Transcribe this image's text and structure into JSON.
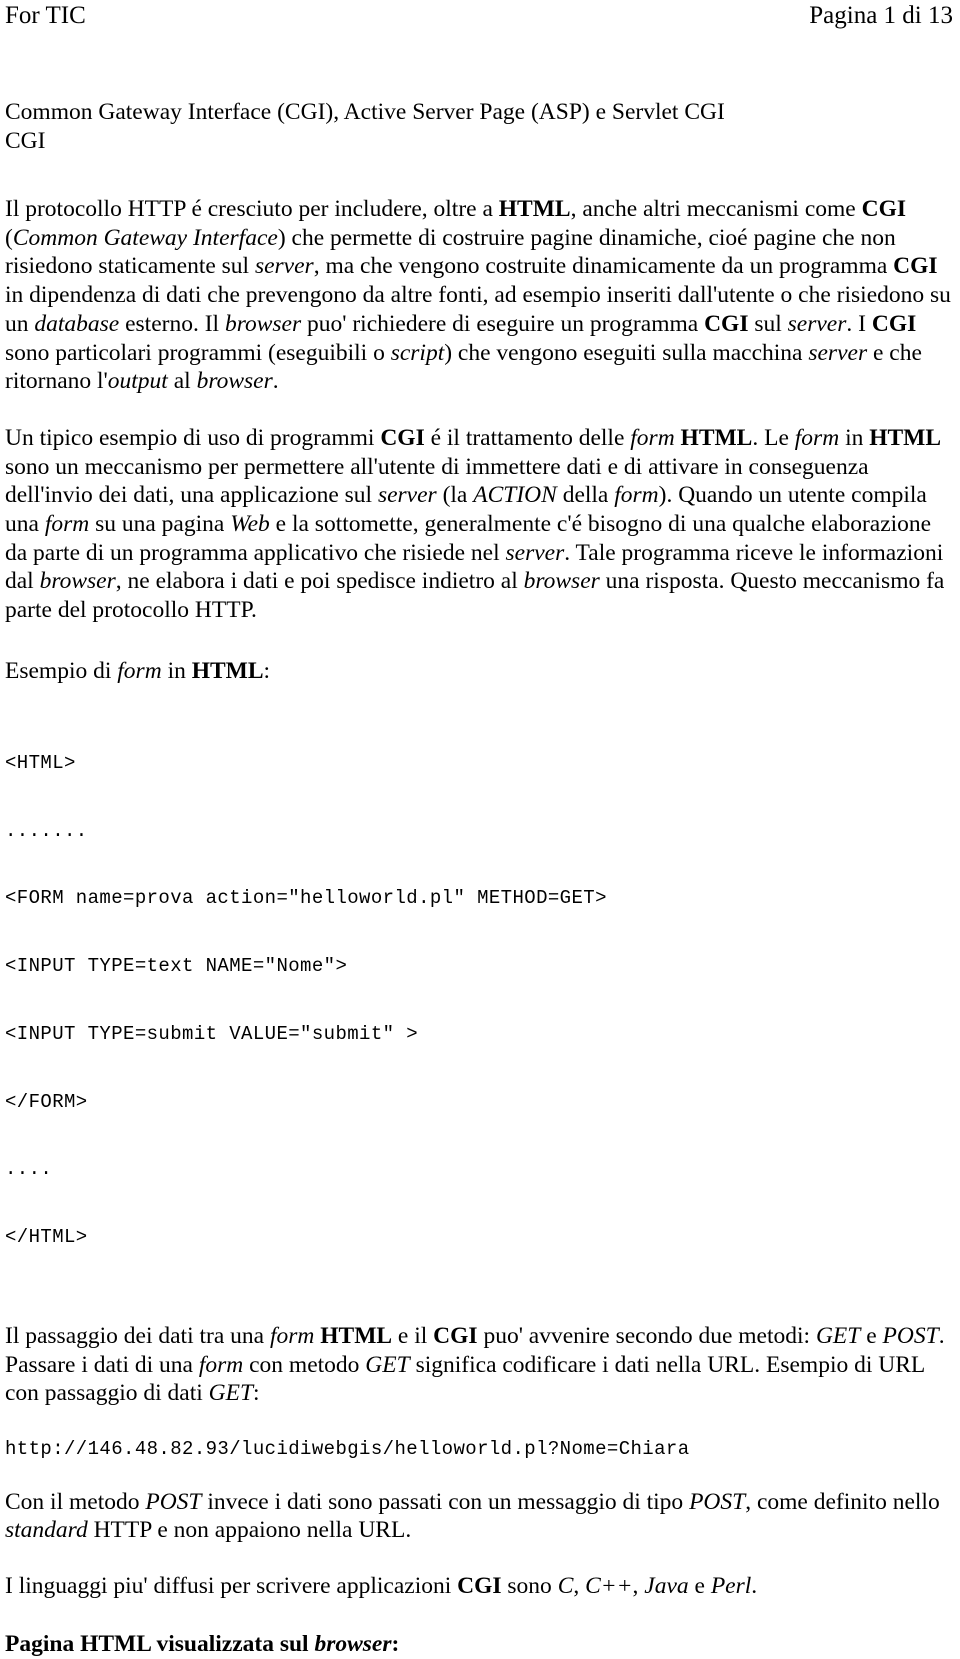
{
  "header": {
    "left": "For TIC",
    "right": "Pagina 1 di 13"
  },
  "document": {
    "title_line_1": "Common Gateway Interface (CGI), Active Server Page (ASP) e Servlet CGI",
    "title_line_2": "CGI",
    "paragraph_1": {
      "s1": "Il protocollo HTTP é cresciuto per includere, oltre a ",
      "b1": "HTML",
      "s2": ", anche altri meccanismi come ",
      "b2": "CGI",
      "s3": " (",
      "i1": "Common Gateway Interface",
      "s4": ") che permette di costruire pagine dinamiche, cioé pagine che non risiedono staticamente sul ",
      "i2": "server",
      "s5": ", ma che vengono costruite dinamicamente da un programma ",
      "b3": "CGI",
      "s6": " in dipendenza di dati che prevengono da altre fonti, ad esempio inseriti dall'utente o che risiedono su un ",
      "i3": "database",
      "s7": " esterno. Il ",
      "i4": "browser",
      "s8": " puo' richiedere di eseguire un programma ",
      "b4": "CGI",
      "s9": " sul ",
      "i5": "server",
      "s10": ". I ",
      "b5": "CGI",
      "s11": " sono particolari programmi (eseguibili o ",
      "i6": "script",
      "s12": ") che vengono eseguiti sulla macchina ",
      "i7": "server",
      "s13": " e che ritornano l'",
      "i8": "output",
      "s14": " al ",
      "i9": "browser",
      "s15": "."
    },
    "paragraph_2": {
      "s1": "Un tipico esempio di uso di programmi ",
      "b1": "CGI",
      "s2": " é il trattamento delle ",
      "i1": "form",
      "s3": " ",
      "b2": "HTML",
      "s4": ". Le ",
      "i2": "form",
      "s5": " in ",
      "b3": "HTML",
      "s6": " sono un meccanismo per permettere all'utente di immettere dati e di attivare in conseguenza dell'invio dei dati, una applicazione sul ",
      "i3": "server",
      "s7": " (la ",
      "i4": "ACTION",
      "s8": " della ",
      "i5": "form",
      "s9": "). Quando un utente compila una ",
      "i6": "form",
      "s10": " su una pagina ",
      "i7": "Web",
      "s11": " e la sottomette, generalmente c'é bisogno di una qualche elaborazione da parte di un programma applicativo che risiede nel ",
      "i8": "server",
      "s12": ". Tale programma riceve le informazioni dal ",
      "i9": "browser",
      "s13": ", ne elabora i dati e poi spedisce indietro al ",
      "i10": "browser",
      "s14": " una risposta. Questo meccanismo fa parte del protocollo HTTP."
    },
    "form_example_lead": {
      "s1": "Esempio di ",
      "i1": "form",
      "s2": " in ",
      "b1": "HTML",
      "s3": ":"
    },
    "code_lines": [
      "<HTML>",
      ".......",
      "<FORM name=prova action=\"helloworld.pl\" METHOD=GET>",
      "<INPUT TYPE=text NAME=\"Nome\">",
      "<INPUT TYPE=submit VALUE=\"submit\" >",
      "</FORM>",
      "....",
      "</HTML>"
    ],
    "paragraph_3": {
      "s1": "Il passaggio dei dati tra una ",
      "i1": "form",
      "s2": " ",
      "b1": "HTML",
      "s3": " e il ",
      "b2": "CGI",
      "s4": " puo' avvenire secondo due metodi: ",
      "i2": "GET",
      "s5": " e ",
      "i3": "POST",
      "s6": ". Passare i dati di una ",
      "i4": "form",
      "s7": " con metodo ",
      "i5": "GET",
      "s8": " significa codificare i dati nella URL. Esempio di URL con passaggio di dati ",
      "i6": "GET",
      "s9": ":"
    },
    "url_example": "http://146.48.82.93/lucidiwebgis/helloworld.pl?Nome=Chiara",
    "paragraph_4": {
      "s1": "Con il metodo ",
      "i1": "POST",
      "s2": " invece i dati sono passati con un messaggio di tipo ",
      "i2": "POST",
      "s3": ", come definito nello ",
      "i3": "standard",
      "s4": " HTTP e non appaiono nella URL."
    },
    "paragraph_5": {
      "s1": "I linguaggi piu' diffusi per scrivere applicazioni ",
      "b1": "CGI",
      "s2": " sono ",
      "i1": "C",
      "s3": ", ",
      "i2": "C++",
      "s4": ", ",
      "i3": "Java",
      "s5": " e ",
      "i4": "Perl",
      "s6": "."
    },
    "closing_line": {
      "b1": "Pagina HTML visualizzata sul ",
      "bi1": "browser",
      "b2": ":"
    }
  }
}
